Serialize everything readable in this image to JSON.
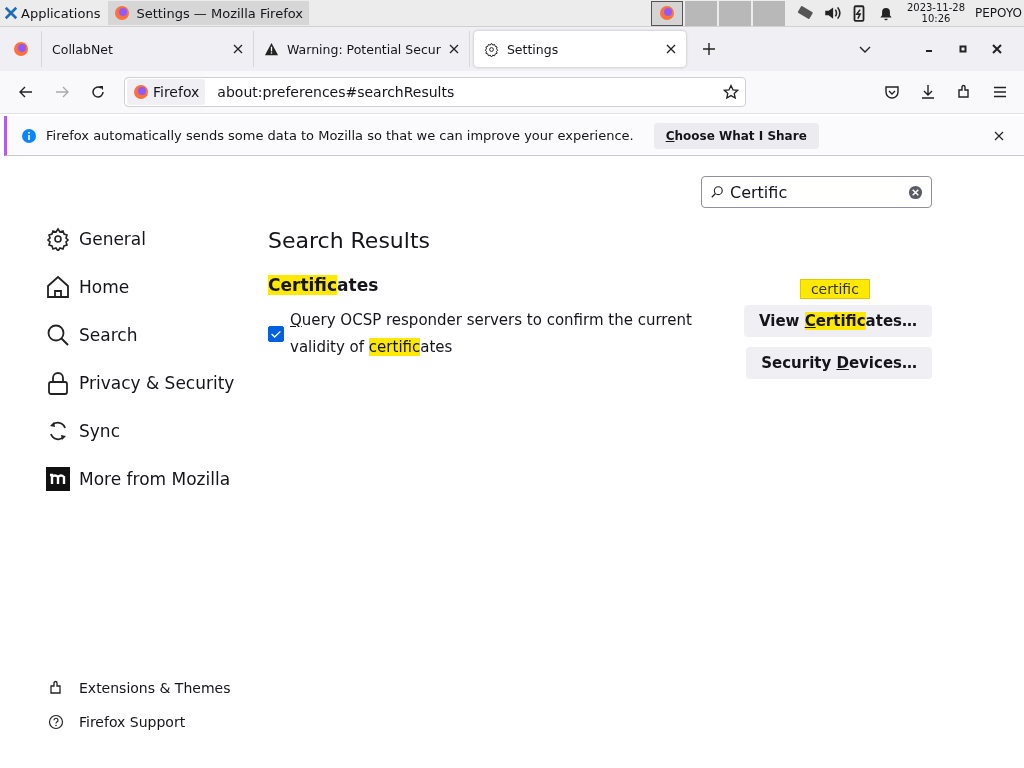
{
  "taskbar": {
    "apps_label": "Applications",
    "task": "Settings — Mozilla Firefox",
    "date": "2023-11-28",
    "time": "10:26",
    "user": "PEPOYO"
  },
  "tabs": [
    {
      "kind": "pinned",
      "selected": false
    },
    {
      "kind": "page",
      "label": "CollabNet",
      "selected": false
    },
    {
      "kind": "page",
      "label": "Warning: Potential Secur",
      "selected": false
    },
    {
      "kind": "page",
      "label": "Settings",
      "selected": true
    }
  ],
  "address_bar": {
    "identity": "Firefox",
    "url": "about:preferences#searchResults"
  },
  "notification": {
    "message": "Firefox automatically sends some data to Mozilla so that we can improve your experience.",
    "button": [
      {
        "text": "C",
        "accesskey": true,
        "mark": false
      },
      {
        "text": "hoose What I Share",
        "accesskey": false,
        "mark": false
      }
    ]
  },
  "search": {
    "value": "Certific"
  },
  "sidebar": {
    "items": [
      {
        "label": "General",
        "selected": false
      },
      {
        "label": "Home",
        "selected": false
      },
      {
        "label": "Search",
        "selected": false
      },
      {
        "label": "Privacy & Security",
        "selected": false
      },
      {
        "label": "Sync",
        "selected": false
      },
      {
        "label": "More from Mozilla",
        "selected": false
      }
    ],
    "footer": [
      {
        "label": "Extensions & Themes"
      },
      {
        "label": "Firefox Support"
      }
    ]
  },
  "results": {
    "heading": "Search Results",
    "group_title": [
      {
        "text": "Certific",
        "accesskey": false,
        "mark": true
      },
      {
        "text": "ates",
        "accesskey": false,
        "mark": false
      }
    ],
    "checkbox": {
      "checked": true,
      "label": [
        {
          "text": "Q",
          "accesskey": true,
          "mark": false
        },
        {
          "text": "uery OCSP responder servers to confirm the current validity of ",
          "accesskey": false,
          "mark": false
        },
        {
          "text": "certific",
          "accesskey": false,
          "mark": true
        },
        {
          "text": "ates",
          "accesskey": false,
          "mark": false
        }
      ]
    },
    "tooltip": "certific",
    "buttons": [
      [
        {
          "text": "View ",
          "accesskey": false,
          "mark": false
        },
        {
          "text": "C",
          "accesskey": true,
          "mark": true
        },
        {
          "text": "ertific",
          "accesskey": false,
          "mark": true
        },
        {
          "text": "ates…",
          "accesskey": false,
          "mark": false
        }
      ],
      [
        {
          "text": "Security ",
          "accesskey": false,
          "mark": false
        },
        {
          "text": "D",
          "accesskey": true,
          "mark": false
        },
        {
          "text": "evices…",
          "accesskey": false,
          "mark": false
        }
      ]
    ]
  }
}
